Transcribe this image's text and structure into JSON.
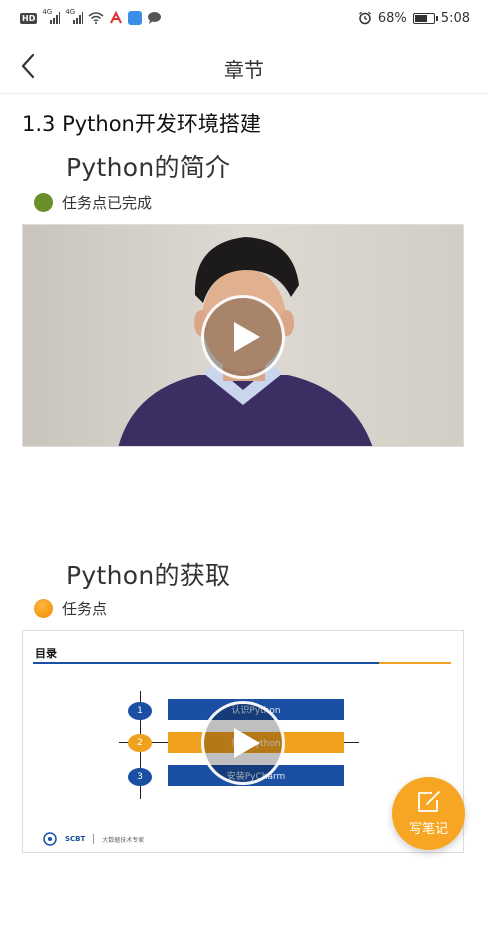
{
  "status_bar": {
    "network_1": "4G",
    "network_2": "4G",
    "battery_percent": "68%",
    "battery_level": 0.68,
    "time": "5:08"
  },
  "nav": {
    "title": "章节",
    "back_icon": "chevron-left-icon"
  },
  "section": {
    "title": "1.3 Python开发环境搭建"
  },
  "items": [
    {
      "title": "Python的简介",
      "task_status": "任务点已完成",
      "status_color": "#6a8f2b",
      "media_type": "video"
    },
    {
      "title": "Python的获取",
      "task_status": "任务点",
      "status_color": "#f08a00",
      "media_type": "slides",
      "slide": {
        "heading": "目录",
        "entries": [
          {
            "num": "1",
            "text": "认识Python"
          },
          {
            "num": "2",
            "text": "获取Python"
          },
          {
            "num": "3",
            "text": "安装PyCharm"
          }
        ],
        "footer_org": "SCBT",
        "footer_text": "大数据技术专家"
      }
    }
  ],
  "fab": {
    "label": "写笔记",
    "icon": "edit-note-icon",
    "color": "#f6a623"
  }
}
